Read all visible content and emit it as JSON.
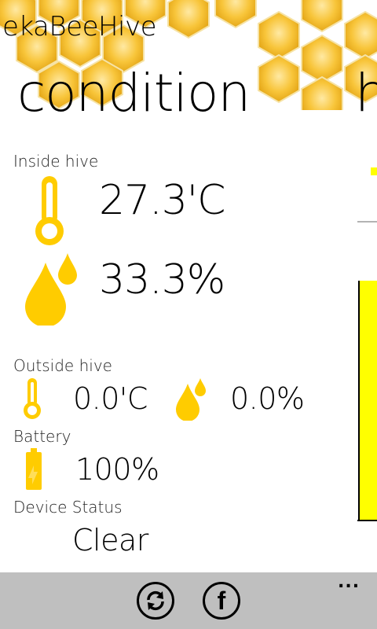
{
  "app": {
    "title": "hekaBeeHive"
  },
  "pivot": {
    "current": "condition",
    "next_peek": "h"
  },
  "inside": {
    "label": "Inside hive",
    "temperature": "27.3'C",
    "humidity": "33.3%"
  },
  "outside": {
    "label": "Outside hive",
    "temperature": "0.0'C",
    "humidity": "0.0%"
  },
  "battery": {
    "label": "Battery",
    "value": "100%",
    "level": 1.0
  },
  "device": {
    "label": "Device Status",
    "value": "Clear"
  },
  "appbar": {
    "buttons": [
      {
        "name": "sync",
        "icon": "refresh-icon"
      },
      {
        "name": "facebook",
        "icon": "facebook-icon",
        "glyph": "f"
      }
    ],
    "more": "..."
  },
  "colors": {
    "accent": "#FFCC00",
    "chart": "#FFFF00",
    "appbar": "#BFBFBF"
  }
}
